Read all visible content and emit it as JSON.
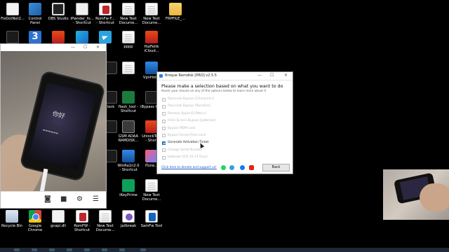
{
  "desktop": {
    "icons": [
      {
        "label": "FixDotNet2...",
        "icon": "file-icon"
      },
      {
        "label": "Control\nPanel",
        "icon": "control-panel-icon"
      },
      {
        "label": "OBS Studio",
        "icon": "obs-icon"
      },
      {
        "label": "iPwnder_fo...\n- Shortcut",
        "icon": "ipwnder-icon"
      },
      {
        "label": "RomFw-F...\n- Shortcut",
        "icon": "romfw-icon"
      },
      {
        "label": "New Text\nDocume...",
        "icon": "text-document-icon"
      },
      {
        "label": "New Text\nDocume...",
        "icon": "text-document-icon"
      },
      {
        "label": "FRPFILE_...",
        "icon": "folder-icon"
      },
      {
        "label": "pppp",
        "icon": "text-document-icon"
      },
      {
        "label": "HaiFeitk\niCloud...",
        "icon": "haifeitk-icon"
      },
      {
        "label": "lock",
        "icon": "app-icon"
      },
      {
        "label": "flash_tool -\nShortcut",
        "icon": "flash-tool-icon"
      },
      {
        "label": "iBypass Hi...",
        "icon": "ibypass-icon"
      },
      {
        "label": "GSM ADAA\nRAMDISK...",
        "icon": "gsm-adaa-icon"
      },
      {
        "label": "UnlockTo...\n- Short",
        "icon": "unlocktool-icon"
      },
      {
        "label": "VpnHot...",
        "icon": "vpn-icon"
      },
      {
        "label": "WinRa1n2.0\n- Shortcut",
        "icon": "winra1n-icon"
      },
      {
        "label": "iTune...",
        "icon": "itunes-icon"
      },
      {
        "label": "iKeyPrime",
        "icon": "ikeyprime-icon"
      },
      {
        "label": "New Text\nDocume...",
        "icon": "text-document-icon"
      },
      {
        "label": "Recycle Bin",
        "icon": "recycle-bin-icon"
      },
      {
        "label": "Google\nChrome",
        "icon": "chrome-icon"
      },
      {
        "label": "gcapi.dll",
        "icon": "dll-file-icon"
      },
      {
        "label": "RomFW -\nShortcut",
        "icon": "romfw-icon"
      },
      {
        "label": "New Text\nDocume...",
        "icon": "text-document-icon"
      },
      {
        "label": "jailbreak",
        "icon": "jailbreak-icon"
      },
      {
        "label": "SamFw Tool",
        "icon": "samfw-icon"
      }
    ]
  },
  "camera_window": {
    "phone_text": "你好",
    "toolbar_icons": [
      "camera-icon",
      "video-icon",
      "settings-icon",
      "menu-icon"
    ]
  },
  "ramdisk_window": {
    "title": "Broque Ramdisk [PRO] v2.5.5",
    "heading": "Please make a selection based on what you want to do",
    "subheading": "Hover your mouse on any of the options below to learn more about it",
    "options": [
      {
        "label": "Passcode Bypass [Checkra1n]",
        "checked": false
      },
      {
        "label": "Passcode Bypass [Ramdisk]",
        "checked": false
      },
      {
        "label": "Remove Apple ID [Menu]",
        "checked": false
      },
      {
        "label": "Hello Screen Bypass [Jailbreak]",
        "checked": false
      },
      {
        "label": "Bypass MDM Lock",
        "checked": false
      },
      {
        "label": "Bypass ScreenTime Lock",
        "checked": false
      },
      {
        "label": "Generate Activation Ticket",
        "checked": true
      },
      {
        "label": "Change Serial Number",
        "checked": false
      },
      {
        "label": "Jailbreak [iOS 15-17 Only]",
        "checked": false
      }
    ],
    "donate_link": "Click here to donate and support us!",
    "back_button": "Back",
    "social_icons": [
      {
        "name": "whatsapp-icon",
        "color": "#25d366"
      },
      {
        "name": "telegram-icon",
        "color": "#2aa3df"
      },
      {
        "name": "facebook-icon",
        "color": "#1877f2"
      },
      {
        "name": "youtube-icon",
        "color": "#e62117"
      }
    ]
  }
}
